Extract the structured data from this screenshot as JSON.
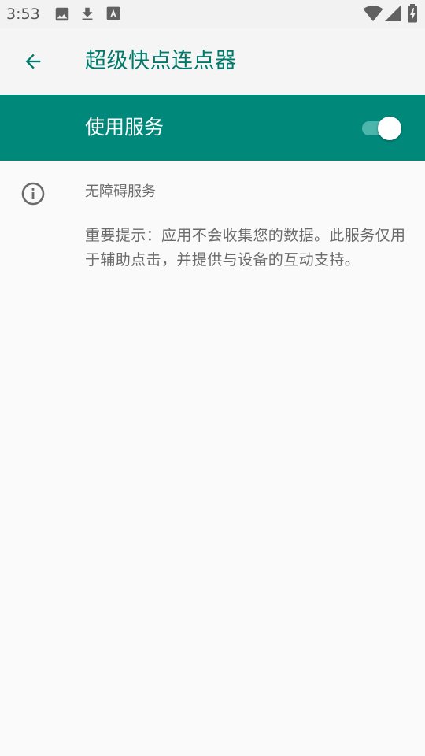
{
  "status_bar": {
    "time": "3:53",
    "icons": [
      "image-icon",
      "download-icon",
      "font-icon",
      "wifi-icon",
      "signal-icon",
      "battery-charging-icon"
    ]
  },
  "toolbar": {
    "back_icon": "arrow-back-icon",
    "title": "超级快点连点器"
  },
  "service": {
    "label": "使用服务",
    "switch_on": true
  },
  "info": {
    "icon": "info-icon",
    "title": "无障碍服务",
    "description": "重要提示：应用不会收集您的数据。此服务仅用于辅助点击，并提供与设备的互动支持。"
  },
  "colors": {
    "accent": "#00897B",
    "title_teal": "#00796B",
    "switch_track": "#4DB6AC",
    "background": "#FAFAFA"
  }
}
